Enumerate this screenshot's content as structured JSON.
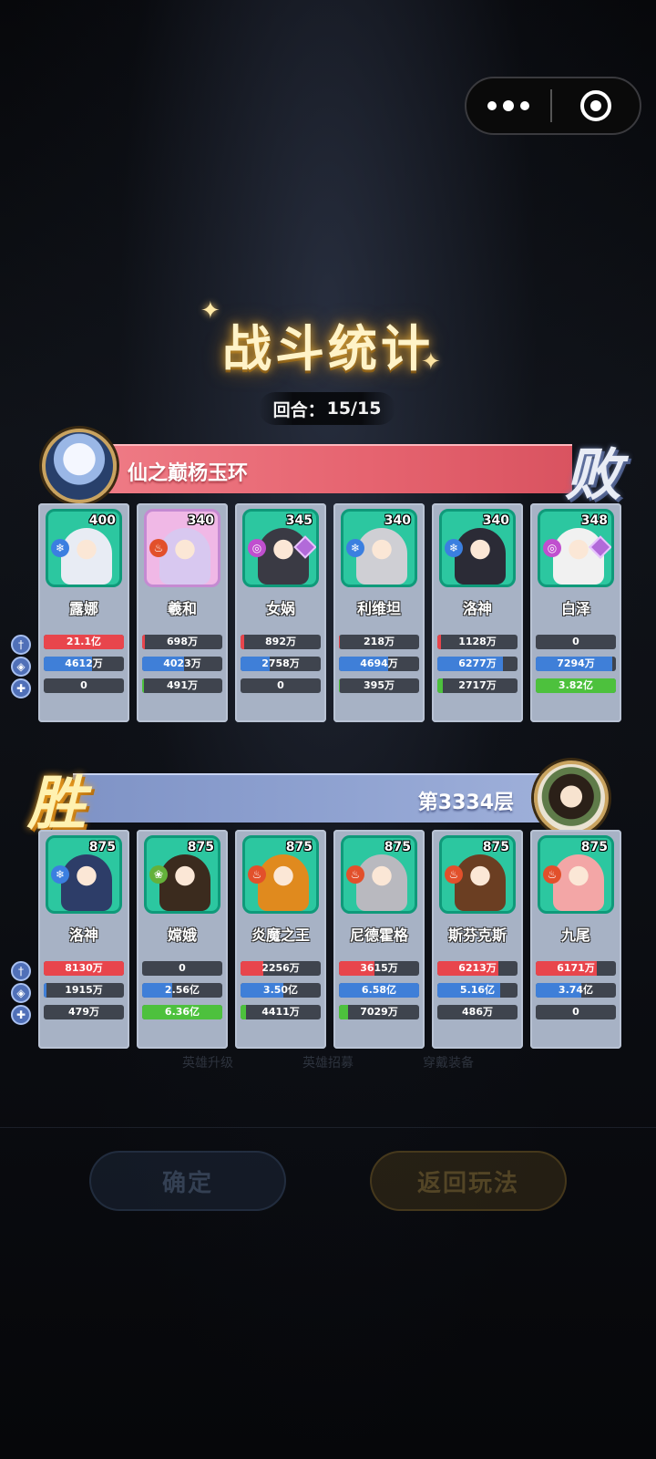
{
  "capsule": {
    "menu_icon": "more-dots-icon",
    "close_icon": "target-icon"
  },
  "title": "战斗统计",
  "round": {
    "label": "回合：",
    "value": "15/15"
  },
  "top_team": {
    "player_name": "仙之巅杨玉环",
    "result": "败",
    "heroes": [
      {
        "name": "露娜",
        "level": "400",
        "element": "ice",
        "frame": "green",
        "stats": {
          "damage": "21.1亿",
          "taken": "4612万",
          "heal": "0"
        },
        "fills": {
          "damage": 1.0,
          "taken": 0.6,
          "heal": 0
        }
      },
      {
        "name": "羲和",
        "level": "340",
        "element": "fire",
        "frame": "pink",
        "stats": {
          "damage": "698万",
          "taken": "4023万",
          "heal": "491万"
        },
        "fills": {
          "damage": 0.03,
          "taken": 0.52,
          "heal": 0.02
        }
      },
      {
        "name": "女娲",
        "level": "345",
        "element": "light",
        "frame": "green",
        "stats": {
          "damage": "892万",
          "taken": "2758万",
          "heal": "0"
        },
        "fills": {
          "damage": 0.04,
          "taken": 0.36,
          "heal": 0
        }
      },
      {
        "name": "利维坦",
        "level": "340",
        "element": "ice",
        "frame": "green",
        "stats": {
          "damage": "218万",
          "taken": "4694万",
          "heal": "395万"
        },
        "fills": {
          "damage": 0.01,
          "taken": 0.61,
          "heal": 0.01
        }
      },
      {
        "name": "洛神",
        "level": "340",
        "element": "ice",
        "frame": "green",
        "stats": {
          "damage": "1128万",
          "taken": "6277万",
          "heal": "2717万"
        },
        "fills": {
          "damage": 0.05,
          "taken": 0.82,
          "heal": 0.07
        }
      },
      {
        "name": "白泽",
        "level": "348",
        "element": "light",
        "frame": "green",
        "stats": {
          "damage": "0",
          "taken": "7294万",
          "heal": "3.82亿"
        },
        "fills": {
          "damage": 0,
          "taken": 0.95,
          "heal": 1.0
        }
      }
    ]
  },
  "bottom_team": {
    "floor": "第3334层",
    "result": "胜",
    "heroes": [
      {
        "name": "洛神",
        "level": "875",
        "element": "ice",
        "frame": "green",
        "stats": {
          "damage": "8130万",
          "taken": "1915万",
          "heal": "479万"
        },
        "fills": {
          "damage": 1.0,
          "taken": 0.03,
          "heal": 0.0
        }
      },
      {
        "name": "嫦娥",
        "level": "875",
        "element": "wood",
        "frame": "green",
        "stats": {
          "damage": "0",
          "taken": "2.56亿",
          "heal": "6.36亿"
        },
        "fills": {
          "damage": 0,
          "taken": 0.38,
          "heal": 1.0
        }
      },
      {
        "name": "炎魔之王",
        "level": "875",
        "element": "fire",
        "frame": "green",
        "stats": {
          "damage": "2256万",
          "taken": "3.50亿",
          "heal": "4411万"
        },
        "fills": {
          "damage": 0.28,
          "taken": 0.53,
          "heal": 0.07
        }
      },
      {
        "name": "尼德霍格",
        "level": "875",
        "element": "fire",
        "frame": "green",
        "stats": {
          "damage": "3615万",
          "taken": "6.58亿",
          "heal": "7029万"
        },
        "fills": {
          "damage": 0.44,
          "taken": 1.0,
          "heal": 0.11
        }
      },
      {
        "name": "斯芬克斯",
        "level": "875",
        "element": "fire",
        "frame": "green",
        "stats": {
          "damage": "6213万",
          "taken": "5.16亿",
          "heal": "486万"
        },
        "fills": {
          "damage": 0.76,
          "taken": 0.78,
          "heal": 0.0
        }
      },
      {
        "name": "九尾",
        "level": "875",
        "element": "fire",
        "frame": "green",
        "stats": {
          "damage": "6171万",
          "taken": "3.74亿",
          "heal": "0"
        },
        "fills": {
          "damage": 0.76,
          "taken": 0.57,
          "heal": 0
        }
      }
    ]
  },
  "stat_icons": [
    "sword-icon",
    "shield-icon",
    "heal-icon"
  ],
  "background": {
    "buttons": [
      "确定",
      "返回玩法"
    ],
    "tabs": [
      "英雄升级",
      "英雄招募",
      "穿戴装备"
    ]
  },
  "colors": {
    "damage": "#e8454c",
    "taken": "#3f7fd8",
    "heal": "#4dc13d",
    "lose_banner": "#e66470",
    "win_banner": "#8ea1d0"
  }
}
